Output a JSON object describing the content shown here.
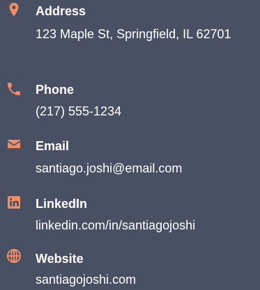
{
  "colors": {
    "background": "#4a5063",
    "accent": "#ef8d66",
    "text": "#ffffff"
  },
  "contacts": [
    {
      "icon": "map-pin-icon",
      "label": "Address",
      "value": "123 Maple St, Springfield, IL 62701"
    },
    {
      "icon": "phone-icon",
      "label": "Phone",
      "value": "(217) 555-1234"
    },
    {
      "icon": "envelope-icon",
      "label": "Email",
      "value": "santiago.joshi@email.com"
    },
    {
      "icon": "linkedin-icon",
      "label": "LinkedIn",
      "value": "linkedin.com/in/santiagojoshi"
    },
    {
      "icon": "globe-icon",
      "label": "Website",
      "value": "santiagojoshi.com"
    }
  ]
}
